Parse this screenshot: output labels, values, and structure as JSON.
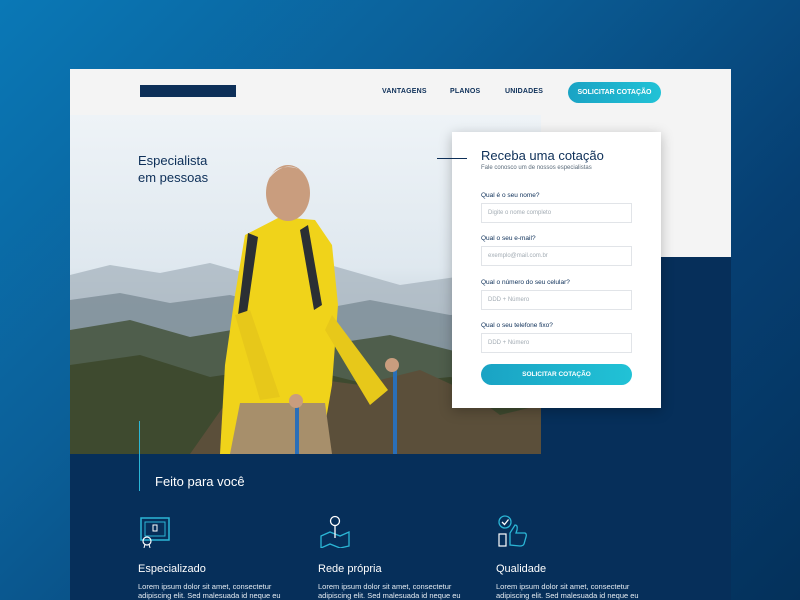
{
  "nav": {
    "items": [
      "VANTAGENS",
      "PLANOS",
      "UNIDADES"
    ],
    "cta": "SOLICITAR COTAÇÃO"
  },
  "hero": {
    "headline": "Especialista\nem pessoas"
  },
  "form": {
    "title": "Receba uma cotação",
    "subtitle": "Fale conosco um de nossos especialistas",
    "fields": [
      {
        "label": "Qual é o seu nome?",
        "placeholder": "Digite o nome completo"
      },
      {
        "label": "Qual o seu e-mail?",
        "placeholder": "exemplo@mail.com.br"
      },
      {
        "label": "Qual o número do seu celular?",
        "placeholder": "DDD + Número"
      },
      {
        "label": "Qual o seu telefone fixo?",
        "placeholder": "DDD + Número"
      }
    ],
    "submit": "SOLICITAR COTAÇÃO"
  },
  "features_section": {
    "title": "Feito para você",
    "items": [
      {
        "icon": "certificate-icon",
        "title": "Especializado",
        "desc": "Lorem ipsum dolor sit amet, consectetur adipiscing elit. Sed malesuada id neque eu accumsan. Pellentesque luctus condimen"
      },
      {
        "icon": "map-pin-icon",
        "title": "Rede própria",
        "desc": "Lorem ipsum dolor sit amet, consectetur adipiscing elit. Sed malesuada id neque eu accumsan. Pellentesque luctus condimen"
      },
      {
        "icon": "thumbs-up-icon",
        "title": "Qualidade",
        "desc": "Lorem ipsum dolor sit amet, consectetur adipiscing elit. Sed malesuada id neque eu accumsan. Pellentesque luctus condimen"
      }
    ]
  },
  "colors": {
    "brand_navy": "#0d2f58",
    "accent_teal": "#21c2d6",
    "section_bg": "#062f5a"
  }
}
